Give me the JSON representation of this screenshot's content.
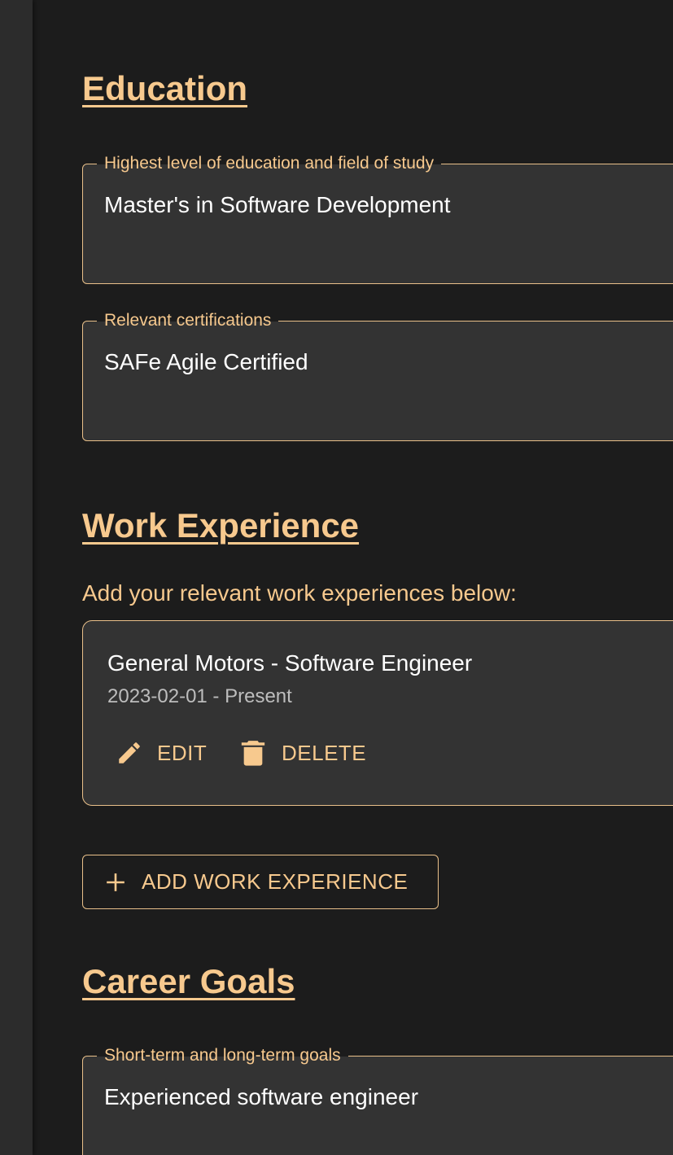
{
  "education": {
    "heading": "Education",
    "highest_level": {
      "label": "Highest level of education and field of study",
      "value": "Master's in Software Development"
    },
    "certifications": {
      "label": "Relevant certifications",
      "value": "SAFe Agile Certified"
    }
  },
  "work_experience": {
    "heading": "Work Experience",
    "helper_text": "Add your relevant work experiences below:",
    "entries": [
      {
        "title": "General Motors - Software Engineer",
        "dates": "2023-02-01 - Present",
        "edit_label": "EDIT",
        "delete_label": "DELETE"
      }
    ],
    "add_button_label": "ADD WORK EXPERIENCE"
  },
  "career_goals": {
    "heading": "Career Goals",
    "goals": {
      "label": "Short-term and long-term goals",
      "value": "Experienced software engineer"
    }
  },
  "icons": {
    "edit": "pencil-icon",
    "delete": "trash-icon",
    "add": "plus-icon"
  },
  "colors": {
    "background": "#1c1c1c",
    "surface": "#333333",
    "accent": "#f7c98e",
    "border": "#e9c08a",
    "text": "#ffffff",
    "secondary_text": "#bdbdbd"
  }
}
